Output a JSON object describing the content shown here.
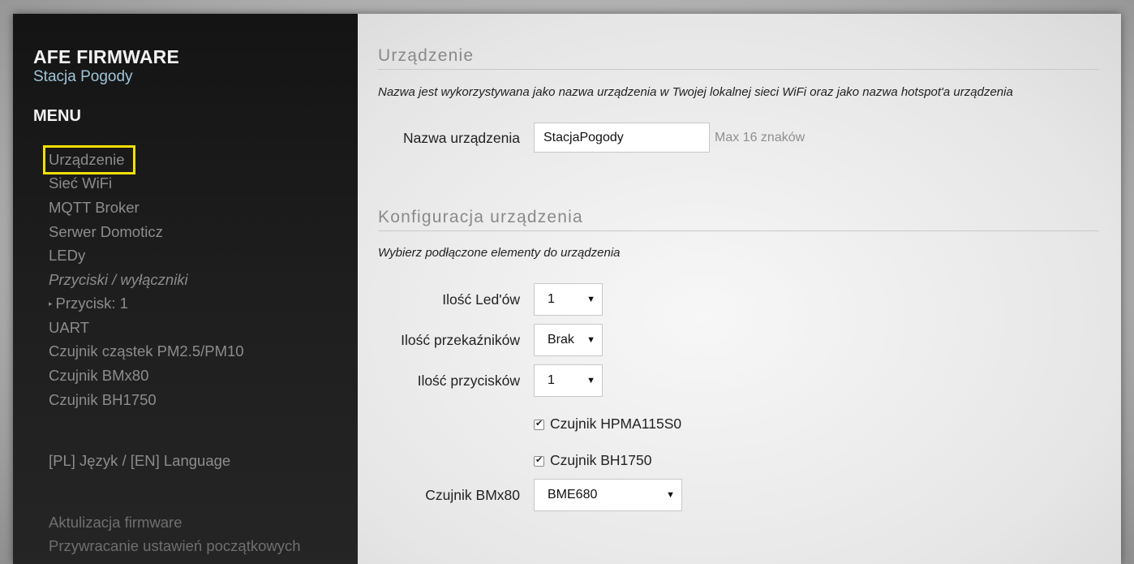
{
  "brand": {
    "title": "AFE FIRMWARE",
    "subtitle": "Stacja Pogody"
  },
  "menu": {
    "heading": "MENU",
    "items": [
      "Urządzenie",
      "Sieć WiFi",
      "MQTT Broker",
      "Serwer Domoticz",
      "LEDy",
      "Przyciski / wyłączniki",
      "Przycisk: 1",
      "UART",
      "Czujnik cząstek PM2.5/PM10",
      "Czujnik BMx80",
      "Czujnik BH1750"
    ],
    "language": "[PL] Język / [EN] Language",
    "firmware_update": "Aktulizacja firmware",
    "factory_reset": "Przywracanie ustawień początkowych",
    "highlight_color": "#f3e000"
  },
  "device": {
    "title": "Urządzenie",
    "description": "Nazwa jest wykorzystywana jako nazwa urządzenia w Twojej lokalnej sieci WiFi oraz jako nazwa hotspot'a urządzenia",
    "name_label": "Nazwa urządzenia",
    "name_value": "StacjaPogody",
    "name_hint": "Max 16 znaków"
  },
  "config": {
    "title": "Konfiguracja urządzenia",
    "description": "Wybierz podłączone elementy do urządzenia",
    "leds_label": "Ilość Led'ów",
    "leds_value": "1",
    "relays_label": "Ilość przekaźników",
    "relays_value": "Brak",
    "buttons_label": "Ilość przycisków",
    "buttons_value": "1",
    "hpma_label": "Czujnik HPMA115S0",
    "hpma_checked": true,
    "bh1750_label": "Czujnik BH1750",
    "bh1750_checked": true,
    "bmx80_label": "Czujnik BMx80",
    "bmx80_value": "BME680"
  }
}
